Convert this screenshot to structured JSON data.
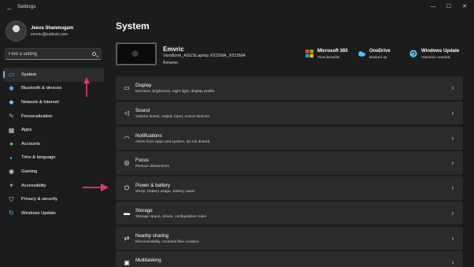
{
  "window": {
    "title": "Settings",
    "back_glyph": "←",
    "minimize_glyph": "—",
    "maximize_glyph": "☐",
    "close_glyph": "✕"
  },
  "user": {
    "name": "Jeeva Shanmugam",
    "email": "emvric@outlook.com"
  },
  "search": {
    "placeholder": "Find a setting",
    "value": ""
  },
  "sidebar": {
    "items": [
      {
        "label": "System",
        "icon": "monitor-icon",
        "glyph": "▭",
        "color": "#4cc2ff",
        "active": true
      },
      {
        "label": "Bluetooth & devices",
        "icon": "bluetooth-icon",
        "glyph": "✱",
        "color": "#4cc2ff",
        "active": false
      },
      {
        "label": "Network & internet",
        "icon": "wifi-icon",
        "glyph": "◆",
        "color": "#7ec8ff",
        "active": false
      },
      {
        "label": "Personalization",
        "icon": "brush-icon",
        "glyph": "✎",
        "color": "#f2a65a",
        "active": false
      },
      {
        "label": "Apps",
        "icon": "apps-icon",
        "glyph": "▦",
        "color": "#cfcfcf",
        "active": false
      },
      {
        "label": "Accounts",
        "icon": "person-icon",
        "glyph": "●",
        "color": "#6ccf6c",
        "active": false
      },
      {
        "label": "Time & language",
        "icon": "globe-clock-icon",
        "glyph": "◐",
        "color": "#4cc2ff",
        "active": false
      },
      {
        "label": "Gaming",
        "icon": "gamepad-icon",
        "glyph": "◉",
        "color": "#cfcfcf",
        "active": false
      },
      {
        "label": "Accessibility",
        "icon": "accessibility-icon",
        "glyph": "✦",
        "color": "#4cc2ff",
        "active": false
      },
      {
        "label": "Privacy & security",
        "icon": "shield-icon",
        "glyph": "⛉",
        "color": "#cfcfcf",
        "active": false
      },
      {
        "label": "Windows Update",
        "icon": "refresh-icon",
        "glyph": "↻",
        "color": "#4cc2ff",
        "active": false
      }
    ]
  },
  "main": {
    "title": "System",
    "device": {
      "name": "Emvric",
      "model": "VivoBook_ASUSLaptop X515MA_X515MA",
      "rename": "Rename"
    },
    "status": [
      {
        "title": "Microsoft 365",
        "sub": "View benefits",
        "icon": "microsoft-logo-icon"
      },
      {
        "title": "OneDrive",
        "sub": "Backed up",
        "icon": "cloud-icon"
      },
      {
        "title": "Windows Update",
        "sub": "Attention needed",
        "icon": "update-icon"
      }
    ],
    "cards": [
      {
        "title": "Display",
        "sub": "Monitors, brightness, night light, display profile",
        "icon": "display-icon",
        "glyph": "▭"
      },
      {
        "title": "Sound",
        "sub": "Volume levels, output, input, sound devices",
        "icon": "speaker-icon",
        "glyph": "◁"
      },
      {
        "title": "Notifications",
        "sub": "Alerts from apps and system, do not disturb",
        "icon": "bell-icon",
        "glyph": "◠"
      },
      {
        "title": "Focus",
        "sub": "Reduce distractions",
        "icon": "focus-icon",
        "glyph": "◎"
      },
      {
        "title": "Power & battery",
        "sub": "Sleep, battery usage, battery saver",
        "icon": "power-icon",
        "glyph": "⏻"
      },
      {
        "title": "Storage",
        "sub": "Storage space, drives, configuration rules",
        "icon": "storage-icon",
        "glyph": "▬"
      },
      {
        "title": "Nearby sharing",
        "sub": "Discoverability, received files location",
        "icon": "share-icon",
        "glyph": "⇄"
      },
      {
        "title": "Multitasking",
        "sub": "",
        "icon": "multitask-icon",
        "glyph": "▣"
      }
    ],
    "chevron_glyph": "›"
  },
  "colors": {
    "accent": "#4cc2ff",
    "annotation_arrow": "#e8336d",
    "background": "#1c1c1c",
    "card": "#2b2b2b"
  }
}
